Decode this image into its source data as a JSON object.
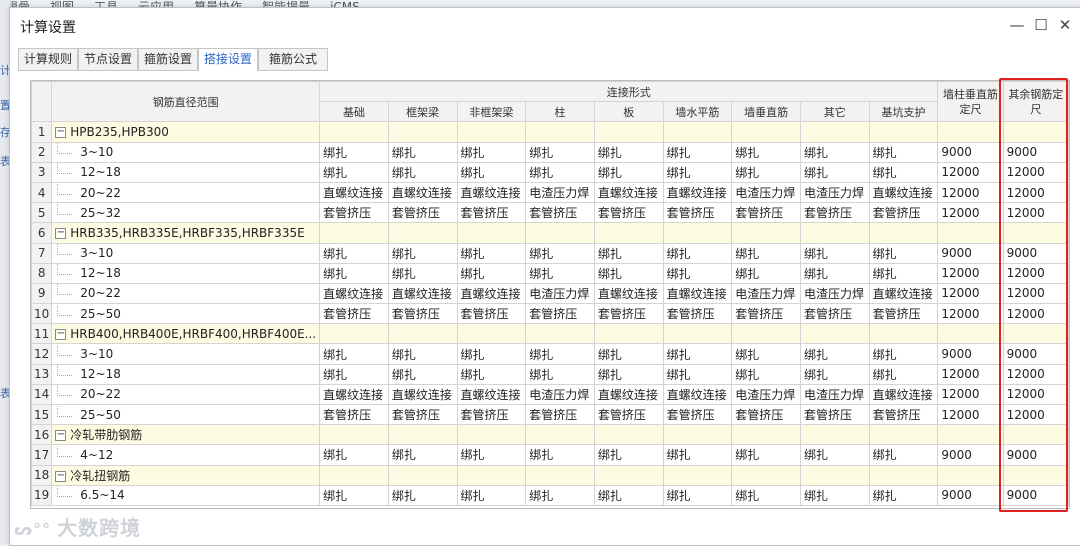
{
  "background": {
    "menu": [
      "辑骨",
      "视图",
      "工具",
      "云应用",
      "算量协作",
      "智能提量",
      "iCMS"
    ],
    "left_glyphs": [
      "计",
      "置",
      "存",
      "表",
      "表"
    ]
  },
  "dialog": {
    "title": "计算设置",
    "controls": {
      "minimize": "—",
      "maximize": "☐",
      "close": "✕"
    }
  },
  "tabs": [
    {
      "label": "计算规则",
      "active": false
    },
    {
      "label": "节点设置",
      "active": false
    },
    {
      "label": "箍筋设置",
      "active": false
    },
    {
      "label": "搭接设置",
      "active": true
    },
    {
      "label": "箍筋公式",
      "active": false
    }
  ],
  "table": {
    "header": {
      "range_col": "钢筋直径范围",
      "conn_group": "连接形式",
      "conn_cols": [
        "基础",
        "框架梁",
        "非框架梁",
        "柱",
        "板",
        "墙水平筋",
        "墙垂直筋",
        "其它",
        "基坑支护"
      ],
      "col_wall": "墙柱垂直筋定尺",
      "col_other": "其余钢筋定尺"
    },
    "rows": [
      {
        "n": "1",
        "group": true,
        "label": "HPB235,HPB300"
      },
      {
        "n": "2",
        "label": "3~10",
        "cells": [
          "绑扎",
          "绑扎",
          "绑扎",
          "绑扎",
          "绑扎",
          "绑扎",
          "绑扎",
          "绑扎",
          "绑扎"
        ],
        "wall": "9000",
        "other": "9000"
      },
      {
        "n": "3",
        "label": "12~18",
        "cells": [
          "绑扎",
          "绑扎",
          "绑扎",
          "绑扎",
          "绑扎",
          "绑扎",
          "绑扎",
          "绑扎",
          "绑扎"
        ],
        "wall": "12000",
        "other": "12000"
      },
      {
        "n": "4",
        "label": "20~22",
        "cells": [
          "直螺纹连接",
          "直螺纹连接",
          "直螺纹连接",
          "电渣压力焊",
          "直螺纹连接",
          "直螺纹连接",
          "电渣压力焊",
          "电渣压力焊",
          "直螺纹连接"
        ],
        "wall": "12000",
        "other": "12000"
      },
      {
        "n": "5",
        "label": "25~32",
        "cells": [
          "套管挤压",
          "套管挤压",
          "套管挤压",
          "套管挤压",
          "套管挤压",
          "套管挤压",
          "套管挤压",
          "套管挤压",
          "套管挤压"
        ],
        "wall": "12000",
        "other": "12000"
      },
      {
        "n": "6",
        "group": true,
        "label": "HRB335,HRB335E,HRBF335,HRBF335E"
      },
      {
        "n": "7",
        "label": "3~10",
        "cells": [
          "绑扎",
          "绑扎",
          "绑扎",
          "绑扎",
          "绑扎",
          "绑扎",
          "绑扎",
          "绑扎",
          "绑扎"
        ],
        "wall": "9000",
        "other": "9000"
      },
      {
        "n": "8",
        "label": "12~18",
        "cells": [
          "绑扎",
          "绑扎",
          "绑扎",
          "绑扎",
          "绑扎",
          "绑扎",
          "绑扎",
          "绑扎",
          "绑扎"
        ],
        "wall": "12000",
        "other": "12000"
      },
      {
        "n": "9",
        "label": "20~22",
        "cells": [
          "直螺纹连接",
          "直螺纹连接",
          "直螺纹连接",
          "电渣压力焊",
          "直螺纹连接",
          "直螺纹连接",
          "电渣压力焊",
          "电渣压力焊",
          "直螺纹连接"
        ],
        "wall": "12000",
        "other": "12000"
      },
      {
        "n": "10",
        "label": "25~50",
        "cells": [
          "套管挤压",
          "套管挤压",
          "套管挤压",
          "套管挤压",
          "套管挤压",
          "套管挤压",
          "套管挤压",
          "套管挤压",
          "套管挤压"
        ],
        "wall": "12000",
        "other": "12000"
      },
      {
        "n": "11",
        "group": true,
        "label": "HRB400,HRB400E,HRBF400,HRBF400E..."
      },
      {
        "n": "12",
        "label": "3~10",
        "cells": [
          "绑扎",
          "绑扎",
          "绑扎",
          "绑扎",
          "绑扎",
          "绑扎",
          "绑扎",
          "绑扎",
          "绑扎"
        ],
        "wall": "9000",
        "other": "9000"
      },
      {
        "n": "13",
        "label": "12~18",
        "cells": [
          "绑扎",
          "绑扎",
          "绑扎",
          "绑扎",
          "绑扎",
          "绑扎",
          "绑扎",
          "绑扎",
          "绑扎"
        ],
        "wall": "12000",
        "other": "12000"
      },
      {
        "n": "14",
        "label": "20~22",
        "cells": [
          "直螺纹连接",
          "直螺纹连接",
          "直螺纹连接",
          "电渣压力焊",
          "直螺纹连接",
          "直螺纹连接",
          "电渣压力焊",
          "电渣压力焊",
          "直螺纹连接"
        ],
        "wall": "12000",
        "other": "12000"
      },
      {
        "n": "15",
        "label": "25~50",
        "cells": [
          "套管挤压",
          "套管挤压",
          "套管挤压",
          "套管挤压",
          "套管挤压",
          "套管挤压",
          "套管挤压",
          "套管挤压",
          "套管挤压"
        ],
        "wall": "12000",
        "other": "12000"
      },
      {
        "n": "16",
        "group": true,
        "label": "冷轧带肋钢筋"
      },
      {
        "n": "17",
        "label": "4~12",
        "cells": [
          "绑扎",
          "绑扎",
          "绑扎",
          "绑扎",
          "绑扎",
          "绑扎",
          "绑扎",
          "绑扎",
          "绑扎"
        ],
        "wall": "9000",
        "other": "9000"
      },
      {
        "n": "18",
        "group": true,
        "label": "冷轧扭钢筋"
      },
      {
        "n": "19",
        "label": "6.5~14",
        "cells": [
          "绑扎",
          "绑扎",
          "绑扎",
          "绑扎",
          "绑扎",
          "绑扎",
          "绑扎",
          "绑扎",
          "绑扎"
        ],
        "wall": "9000",
        "other": "9000"
      }
    ]
  },
  "highlight_color": "#e02020",
  "watermark": {
    "logo": "ᔕ°°",
    "text": "大数跨境"
  }
}
